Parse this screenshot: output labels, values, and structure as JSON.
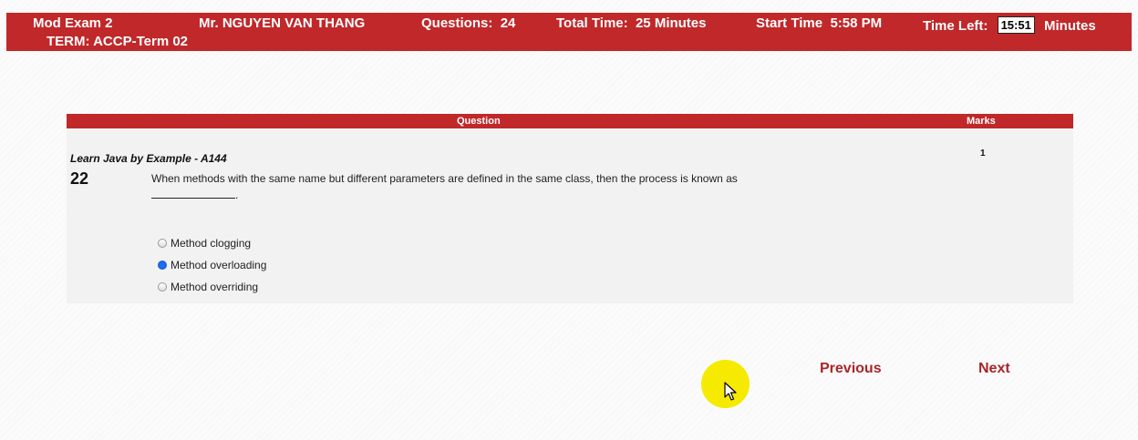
{
  "header": {
    "exam_name": "Mod Exam 2",
    "term": "TERM: ACCP-Term 02",
    "student_name": "Mr. NGUYEN VAN THANG",
    "questions_label": "Questions:",
    "questions_count": "24",
    "total_time_label": "Total Time:",
    "total_time_value": "25 Minutes",
    "start_time_label": "Start Time",
    "start_time_value": "5:58 PM",
    "time_left_label": "Time Left:",
    "time_left_value": "15:51",
    "time_left_unit": "Minutes"
  },
  "question_table": {
    "col_question": "Question",
    "col_marks": "Marks",
    "subject": "Learn Java by Example - A144",
    "number": "22",
    "text": "When methods with the same name but different parameters are defined in the same class, then the process is known as",
    "blank_suffix": ".",
    "marks": "1",
    "options": [
      {
        "label": "Method clogging",
        "selected": false
      },
      {
        "label": "Method overloading",
        "selected": true
      },
      {
        "label": "Method overriding",
        "selected": false
      }
    ]
  },
  "nav": {
    "previous": "Previous",
    "next": "Next"
  },
  "colors": {
    "header_bg": "#c0282a",
    "nav_link": "#a8262a",
    "cursor_highlight": "#f5ea00",
    "radio_selected": "#1e6ff0"
  },
  "icons": {
    "cursor": "mouse-pointer-icon"
  }
}
